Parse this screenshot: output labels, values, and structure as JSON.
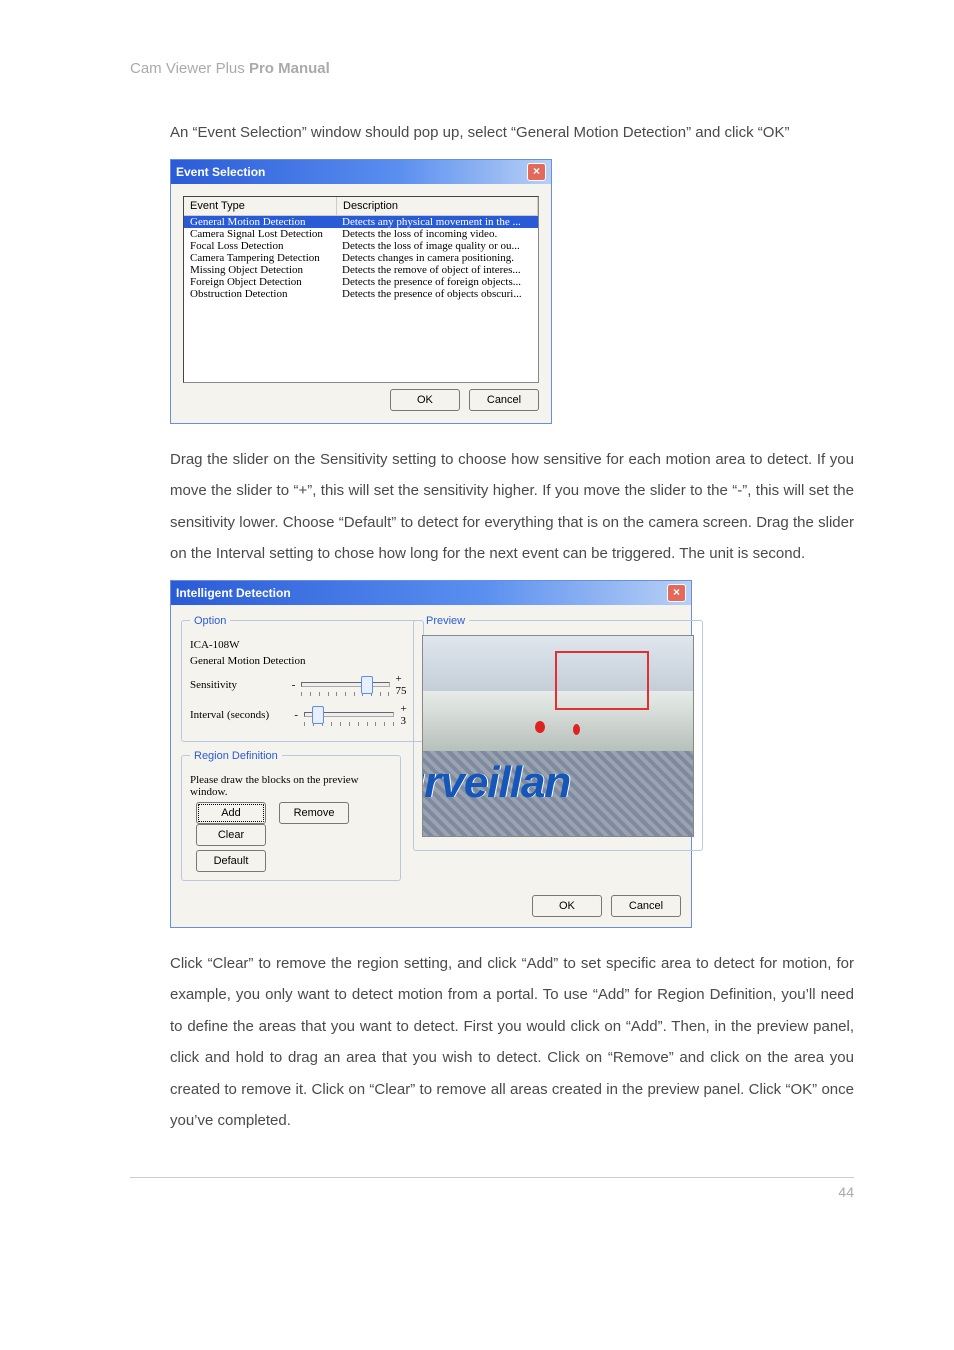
{
  "header": {
    "product": "Cam Viewer Plus ",
    "manual": "Pro Manual"
  },
  "body": {
    "p1": "An “Event Selection” window should pop up, select “General Motion Detection” and click “OK”",
    "p2": "Drag the slider on the Sensitivity setting to choose how sensitive for each motion area to detect. If you move the slider to “+”, this will set the sensitivity higher. If you move the slider to the “-”, this will set the sensitivity lower. Choose “Default” to detect for everything that is on the camera screen. Drag the slider on the Interval setting to chose how long for the next event can be triggered. The unit is second.",
    "p3": "Click “Clear” to remove the region setting, and click “Add” to set specific area to detect for motion, for example, you only want to detect motion from a portal. To use “Add” for Region Definition, you’ll need to define the areas that you want to detect. First you would click on “Add”. Then, in the preview panel, click and hold to drag an area that you wish to detect. Click on “Remove” and click on the area you created to remove it. Click on “Clear” to remove all areas created in the preview panel. Click “OK” once you’ve completed."
  },
  "eventDialog": {
    "title": "Event Selection",
    "col1": "Event Type",
    "col2": "Description",
    "rows": [
      {
        "name": "General Motion Detection",
        "desc": "Detects any physical movement in the ..."
      },
      {
        "name": "Camera Signal Lost Detection",
        "desc": "Detects the loss of incoming video."
      },
      {
        "name": "Focal Loss Detection",
        "desc": "Detects the loss of image quality or ou..."
      },
      {
        "name": "Camera Tampering Detection",
        "desc": "Detects changes in camera positioning."
      },
      {
        "name": "Missing Object Detection",
        "desc": "Detects the remove of object of interes..."
      },
      {
        "name": "Foreign Object Detection",
        "desc": "Detects the presence of foreign objects..."
      },
      {
        "name": "Obstruction Detection",
        "desc": "Detects the presence of objects obscuri..."
      }
    ],
    "ok": "OK",
    "cancel": "Cancel"
  },
  "intDialog": {
    "title": "Intelligent Detection",
    "option": {
      "legend": "Option",
      "device": "ICA-108W",
      "mode": "General Motion Detection",
      "sensLabel": "Sensitivity",
      "sensValue": "+ 75",
      "intervalLabel": "Interval (seconds)",
      "intervalValue": "+ 3"
    },
    "region": {
      "legend": "Region Definition",
      "instruction": "Please draw the blocks on the preview window.",
      "add": "Add",
      "remove": "Remove",
      "clear": "Clear",
      "default": "Default"
    },
    "preview": {
      "legend": "Preview",
      "text": "ırveillan"
    },
    "ok": "OK",
    "cancel": "Cancel"
  },
  "footer": {
    "pageNumber": "44"
  }
}
